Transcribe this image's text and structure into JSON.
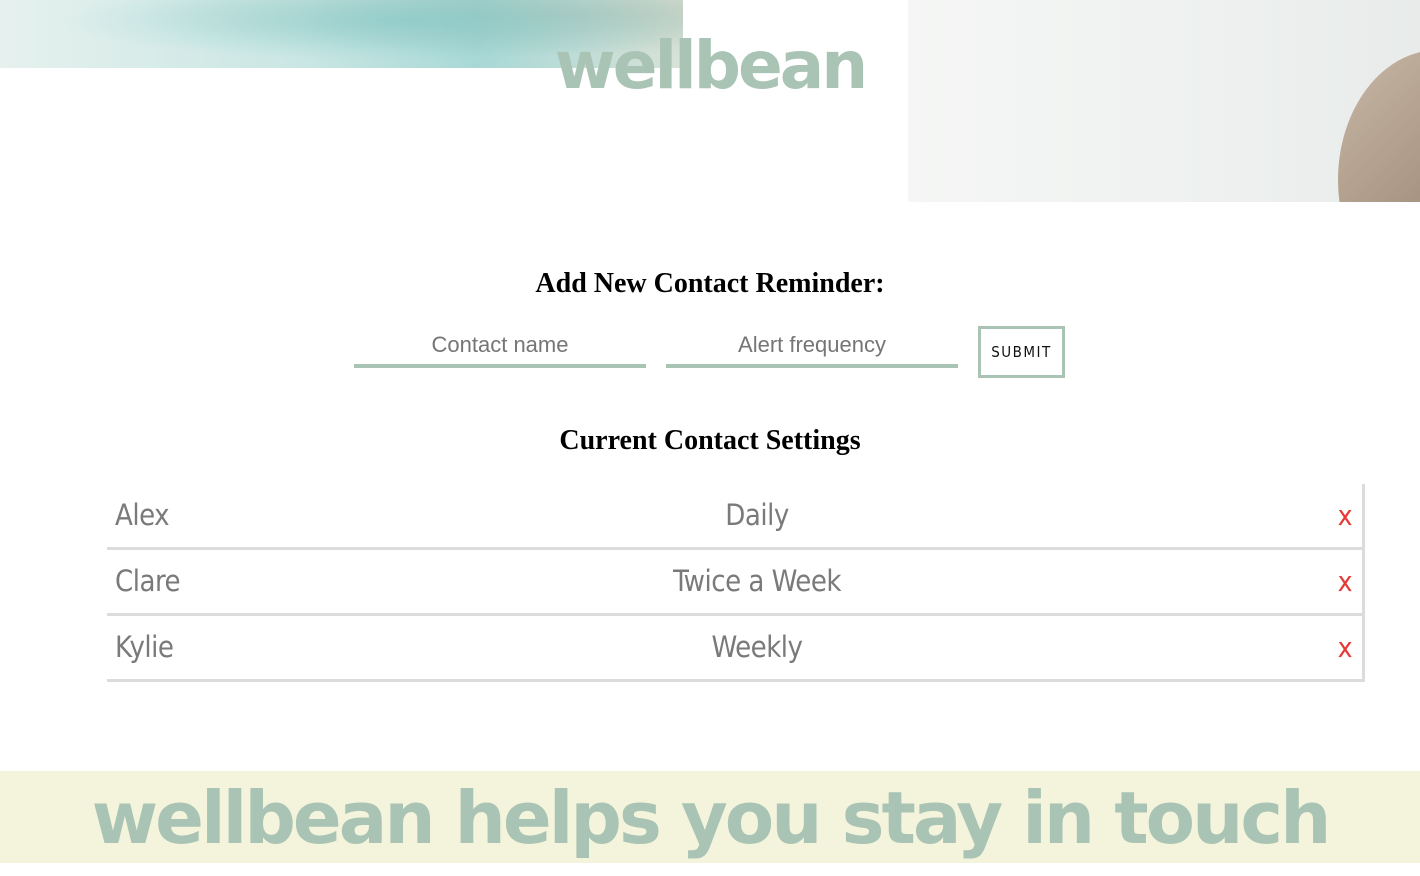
{
  "header": {
    "logo_text": "wellbean"
  },
  "form": {
    "title": "Add New Contact Reminder:",
    "name_placeholder": "Contact name",
    "frequency_placeholder": "Alert frequency",
    "submit_label": "SUBMIT"
  },
  "contacts": {
    "title": "Current Contact Settings",
    "delete_label": "x",
    "rows": [
      {
        "name": "Alex",
        "frequency": "Daily"
      },
      {
        "name": "Clare",
        "frequency": "Twice a Week"
      },
      {
        "name": "Kylie",
        "frequency": "Weekly"
      }
    ]
  },
  "footer": {
    "banner_text": "wellbean helps you stay in touch"
  },
  "colors": {
    "accent_sage": "#a9c4b4",
    "delete_red": "#e53935",
    "banner_bg": "#f4f3dc",
    "row_text": "#7a7a7a"
  },
  "icons": {
    "delete": "close-icon"
  }
}
